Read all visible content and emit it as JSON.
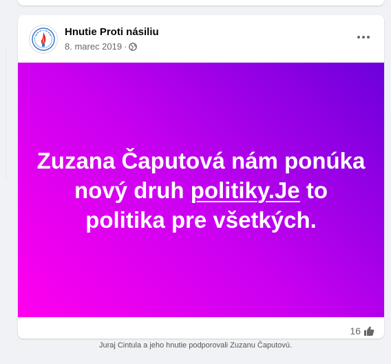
{
  "post": {
    "author": "Hnutie Proti násiliu",
    "date": "8. marec 2019",
    "separator": "·",
    "privacy_icon": "globe-icon",
    "more_icon": "more-options-icon",
    "text_line1": "Zuzana Čaputová nám ponúka",
    "text_line2a": "nový druh ",
    "text_link": "politiky.Je",
    "text_line2b": " to",
    "text_line3": "politika pre všetkých.",
    "background_colors": [
      "#ff00ee",
      "#cc00f0",
      "#6c00dc"
    ],
    "reaction_count": "16",
    "reaction_icon": "like-icon"
  },
  "caption": "Juraj Cintula a jeho hnutie podporovali Zuzanu Čaputovú."
}
